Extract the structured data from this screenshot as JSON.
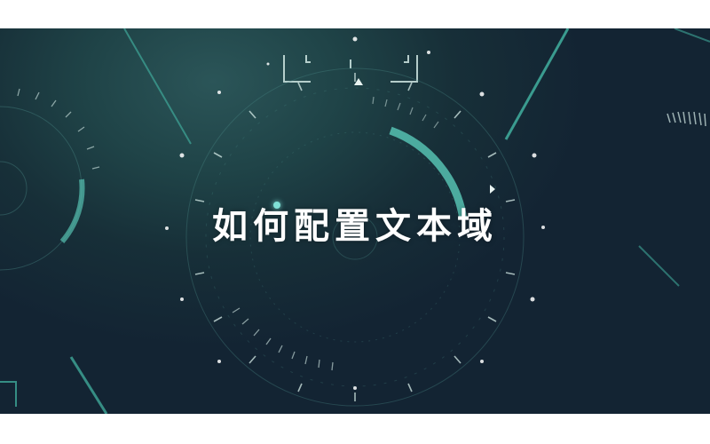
{
  "video": {
    "title": "如何配置文本域"
  },
  "colors": {
    "accent": "#4fb3a6",
    "background": "#172f38",
    "title_text": "#ffffff"
  },
  "icons": {
    "decor": "hud-circle-ring-icon"
  }
}
